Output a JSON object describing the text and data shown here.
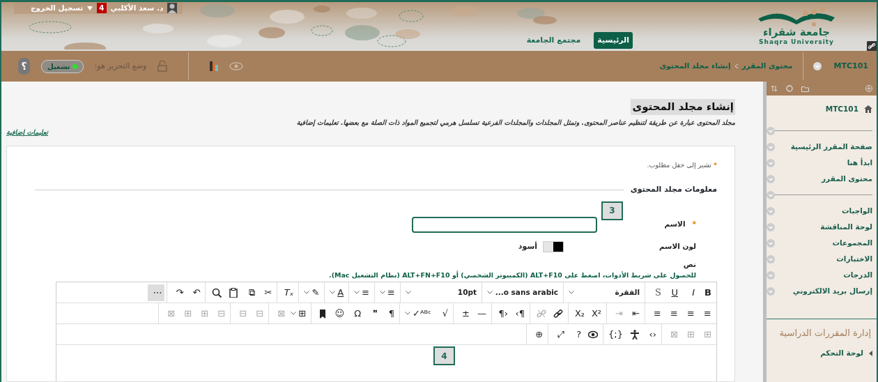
{
  "header": {
    "logout": "تسجيل الخروج",
    "notifications": "4",
    "user_name": "د. سعد الأكلبي",
    "logo": {
      "arabic": "جامعة شقراء",
      "english": "Shaqra University"
    },
    "tabs": [
      {
        "label": "الرئيسية",
        "selected": true
      },
      {
        "label": "مجتمع الجامعة",
        "selected": false
      }
    ]
  },
  "course_bar": {
    "course": "MTC101",
    "breadcrumb": [
      "محتوى المقرر",
      "إنشاء مجلد المحتوى"
    ],
    "edit_mode": {
      "label": "وضع التحرير هو:",
      "value": "تشغيل",
      "on": true
    },
    "help": "؟"
  },
  "page": {
    "title": "إنشاء مجلد المحتوى",
    "description": "مجلد المحتوى عبارة عن طريقة لتنظيم عناصر المحتوى. وتمثل المجلدات والمجلدات الفرعية تسلسل هرمي لتجميع المواد ذات الصلة مع بعضها. تعليمات إضافية",
    "help_link": "تعليمات إضافية",
    "required_mark": "*",
    "required_note": "تشير إلى حقل مطلوب.",
    "section": "معلومات مجلد المحتوى",
    "name_field": {
      "label": "الاسم",
      "required": true,
      "focused": true,
      "step": "3"
    },
    "color_field": {
      "label": "لون الاسم",
      "color": "#000000",
      "value": "أسود"
    },
    "text_field": {
      "label": "نص",
      "hint": "للحصول على شريط الأدوات، اضغط على ALT+F10 (الكمبيوتر الشخصي) أو ALT+FN+F10 (نظام التشغيل Mac).",
      "step": "4",
      "toolbar": [
        [
          [
            {
              "t": "B",
              "kind": "bold"
            },
            {
              "t": "I",
              "kind": "italic"
            },
            {
              "t": "U",
              "kind": "underline"
            },
            {
              "t": "S",
              "kind": "strike"
            }
          ],
          [
            {
              "t": "الفقرة",
              "kind": "select",
              "dropdown": true
            }
          ],
          [
            {
              "t": "...o sans arabic",
              "kind": "select",
              "dropdown": true
            }
          ],
          [
            {
              "t": "10pt",
              "kind": "select",
              "dropdown": true
            }
          ],
          [
            {
              "t": "≡",
              "dropdown": true
            }
          ],
          [
            {
              "t": "≡",
              "dropdown": true
            }
          ],
          [
            {
              "t": "A",
              "kind": "underline",
              "dropdown": true
            }
          ],
          [
            {
              "t": "✎",
              "dropdown": true
            }
          ],
          [
            {
              "t": "Tₓ",
              "kind": "italic"
            }
          ],
          [
            {
              "t": "✂"
            },
            {
              "t": "⧉"
            },
            {
              "kind": "paste"
            },
            {
              "kind": "search"
            }
          ],
          [
            {
              "t": "↶"
            },
            {
              "t": "↷"
            }
          ],
          [
            {
              "t": "⋯",
              "on": true
            }
          ]
        ],
        [
          [
            {
              "t": "≡"
            },
            {
              "t": "≡"
            },
            {
              "t": "≡"
            },
            {
              "t": "≡"
            }
          ],
          [
            {
              "t": "⇤"
            },
            {
              "t": "⇥",
              "disabled": true
            }
          ],
          [
            {
              "t": "X²"
            },
            {
              "t": "X₂"
            }
          ],
          [
            {
              "kind": "link"
            },
            {
              "kind": "unlink",
              "disabled": true
            }
          ],
          [
            {
              "t": "¶›"
            },
            {
              "t": "‹¶"
            }
          ],
          [
            {
              "t": "—"
            },
            {
              "t": "±"
            }
          ],
          [
            {
              "t": "√"
            },
            {
              "t": "ᴬᴮᶜ✓",
              "dropdown": true
            }
          ],
          [
            {
              "t": "¶"
            },
            {
              "t": "❞"
            },
            {
              "t": "Ω"
            },
            {
              "t": "☺"
            },
            {
              "kind": "bookmark"
            }
          ],
          [
            {
              "t": "⊞",
              "dropdown": true
            },
            {
              "t": "⊠",
              "disabled": true
            }
          ],
          [
            {
              "t": "⊟",
              "disabled": true
            },
            {
              "t": "⊟",
              "disabled": true
            }
          ],
          [
            {
              "t": "⊟",
              "disabled": true
            },
            {
              "t": "⊞",
              "disabled": true
            },
            {
              "t": "⊞",
              "disabled": true
            },
            {
              "t": "⊠",
              "disabled": true
            }
          ]
        ],
        [
          [
            {
              "t": "⊞",
              "disabled": true
            },
            {
              "t": "⊞",
              "disabled": true
            },
            {
              "t": "⊠",
              "disabled": true
            }
          ],
          [
            {
              "t": "‹›"
            },
            {
              "kind": "person"
            },
            {
              "t": "{;}"
            }
          ],
          [
            {
              "kind": "eye"
            },
            {
              "t": "?"
            },
            {
              "t": "⤢"
            }
          ],
          [
            {
              "t": "⊕"
            }
          ]
        ]
      ]
    }
  },
  "sidebar": {
    "course": "MTC101",
    "items": [
      {
        "kind": "divider"
      },
      {
        "kind": "link",
        "label": "صفحة المقرر الرئيسية"
      },
      {
        "kind": "link",
        "label": "ابدأ هنا"
      },
      {
        "kind": "link",
        "label": "محتوى المقرر"
      },
      {
        "kind": "divider"
      },
      {
        "kind": "link",
        "label": "الواجبات"
      },
      {
        "kind": "link",
        "label": "لوحة المناقشة"
      },
      {
        "kind": "link",
        "label": "المجموعات"
      },
      {
        "kind": "link",
        "label": "الاختبارات"
      },
      {
        "kind": "link",
        "label": "الدرجات"
      },
      {
        "kind": "link",
        "label": "إرسال بريد الالكتروني"
      }
    ],
    "management_title": "إدارة المقررات الدراسية",
    "control_panel": "لوحة التحكم"
  }
}
